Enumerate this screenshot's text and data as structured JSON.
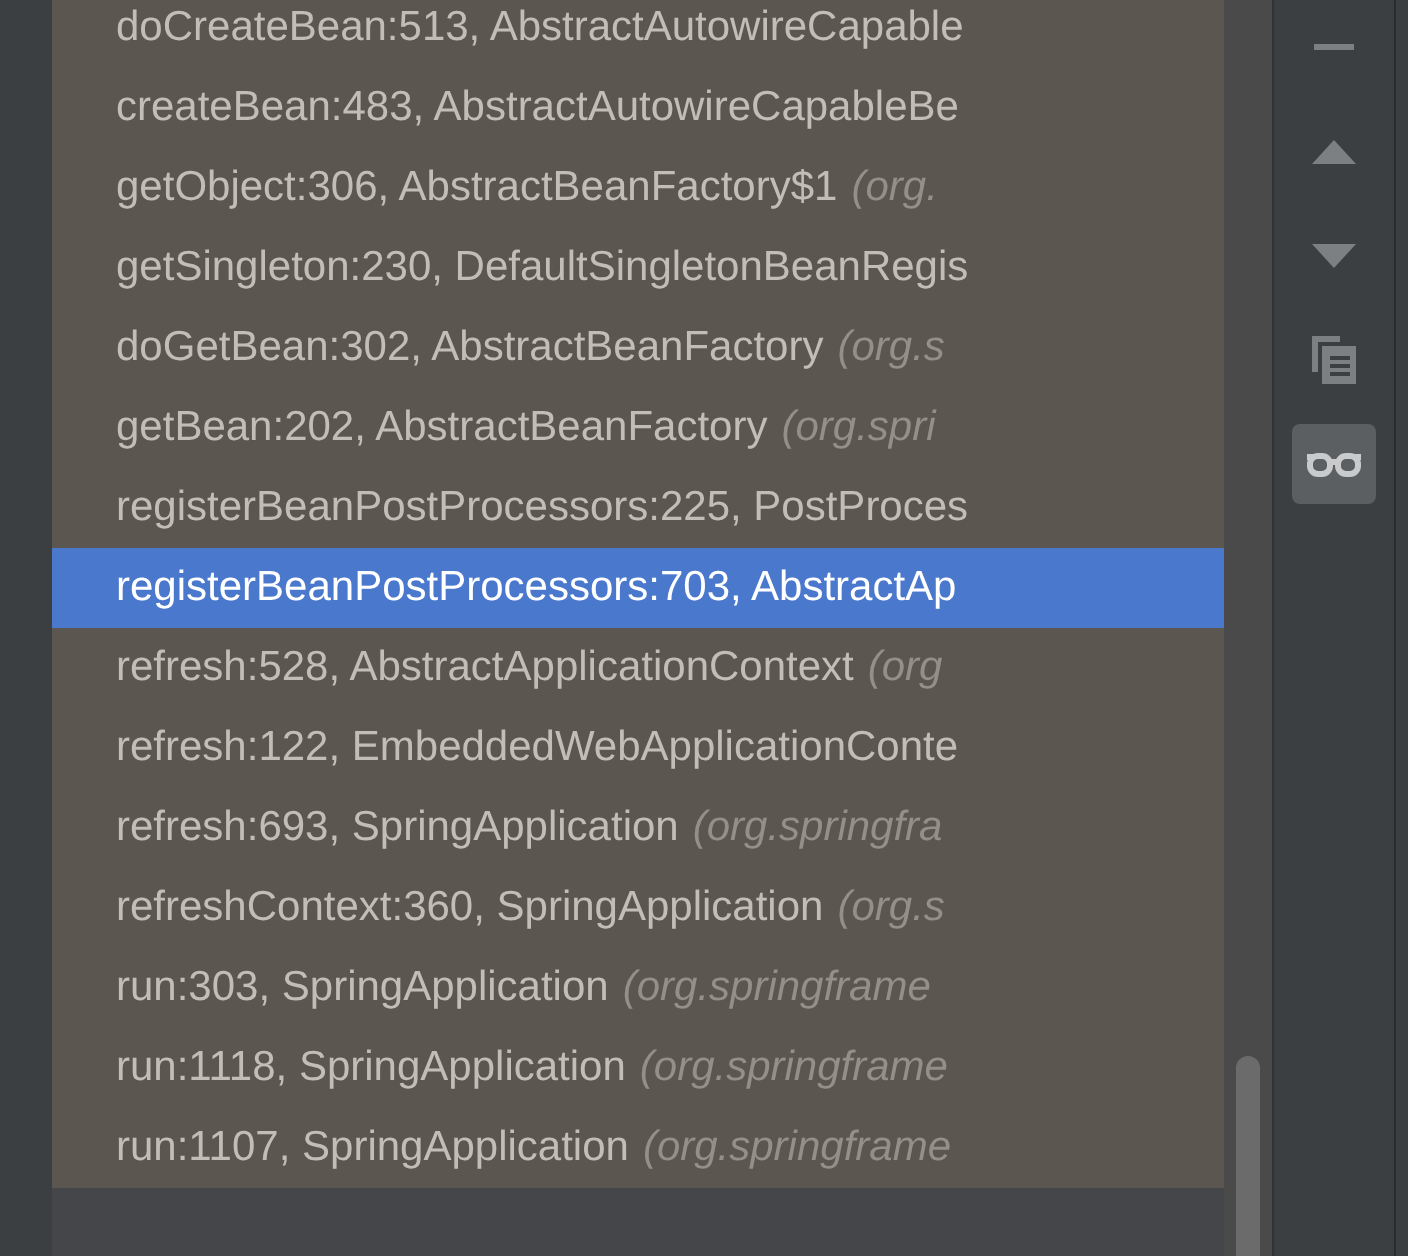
{
  "frames": [
    {
      "frame": "doCreateBean:513, AbstractAutowireCapable",
      "selected": false
    },
    {
      "frame": "createBean:483, AbstractAutowireCapableBe",
      "selected": false
    },
    {
      "frame": "getObject:306, AbstractBeanFactory$1",
      "package": "(org.",
      "selected": false
    },
    {
      "frame": "getSingleton:230, DefaultSingletonBeanRegis",
      "selected": false
    },
    {
      "frame": "doGetBean:302, AbstractBeanFactory",
      "package": "(org.s",
      "selected": false
    },
    {
      "frame": "getBean:202, AbstractBeanFactory",
      "package": "(org.spri",
      "selected": false
    },
    {
      "frame": "registerBeanPostProcessors:225, PostProces",
      "selected": false
    },
    {
      "frame": "registerBeanPostProcessors:703, AbstractAp",
      "selected": true
    },
    {
      "frame": "refresh:528, AbstractApplicationContext",
      "package": "(org",
      "selected": false
    },
    {
      "frame": "refresh:122, EmbeddedWebApplicationConte",
      "selected": false
    },
    {
      "frame": "refresh:693, SpringApplication",
      "package": "(org.springfra",
      "selected": false
    },
    {
      "frame": "refreshContext:360, SpringApplication",
      "package": "(org.s",
      "selected": false
    },
    {
      "frame": "run:303, SpringApplication",
      "package": "(org.springframe",
      "selected": false
    },
    {
      "frame": "run:1118, SpringApplication",
      "package": "(org.springframe",
      "selected": false
    },
    {
      "frame": "run:1107, SpringApplication",
      "package": "(org.springframe",
      "selected": false
    }
  ],
  "toolbar": [
    {
      "kind": "minus",
      "selected": false
    },
    {
      "kind": "up",
      "selected": false
    },
    {
      "kind": "down",
      "selected": false
    },
    {
      "kind": "copy",
      "selected": false
    },
    {
      "kind": "glasses",
      "selected": true
    }
  ]
}
